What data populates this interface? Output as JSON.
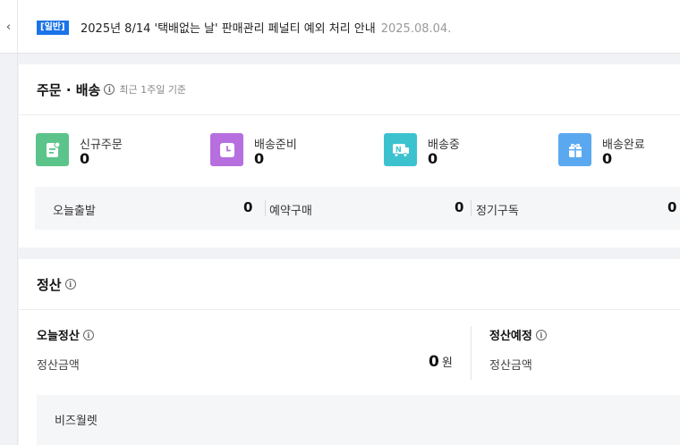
{
  "notice": {
    "badge": "[일반]",
    "text": "2025년 8/14 '택배없는 날' 판매관리 페널티 예외 처리 안내",
    "date": "2025.08.04."
  },
  "orders": {
    "title": "주문 · 배송",
    "subtitle": "최근 1주일 기준",
    "stats": [
      {
        "label": "신규주문",
        "value": "0",
        "icon": "new-order-icon",
        "color": "#5cc48a"
      },
      {
        "label": "배송준비",
        "value": "0",
        "icon": "clock-icon",
        "color": "#b76fe0"
      },
      {
        "label": "배송중",
        "value": "0",
        "icon": "delivery-truck-icon",
        "color": "#3cc2cf"
      },
      {
        "label": "배송완료",
        "value": "0",
        "icon": "gift-box-icon",
        "color": "#5aa9f0"
      }
    ],
    "sub": [
      {
        "label": "오늘출발",
        "value": "0"
      },
      {
        "label": "예약구매",
        "value": "0"
      },
      {
        "label": "정기구독",
        "value": "0"
      }
    ]
  },
  "settlement": {
    "title": "정산",
    "today": {
      "title": "오늘정산",
      "label": "정산금액",
      "value": "0",
      "unit": "원"
    },
    "scheduled": {
      "title": "정산예정",
      "label": "정산금액"
    },
    "wallet": "비즈월렛"
  }
}
